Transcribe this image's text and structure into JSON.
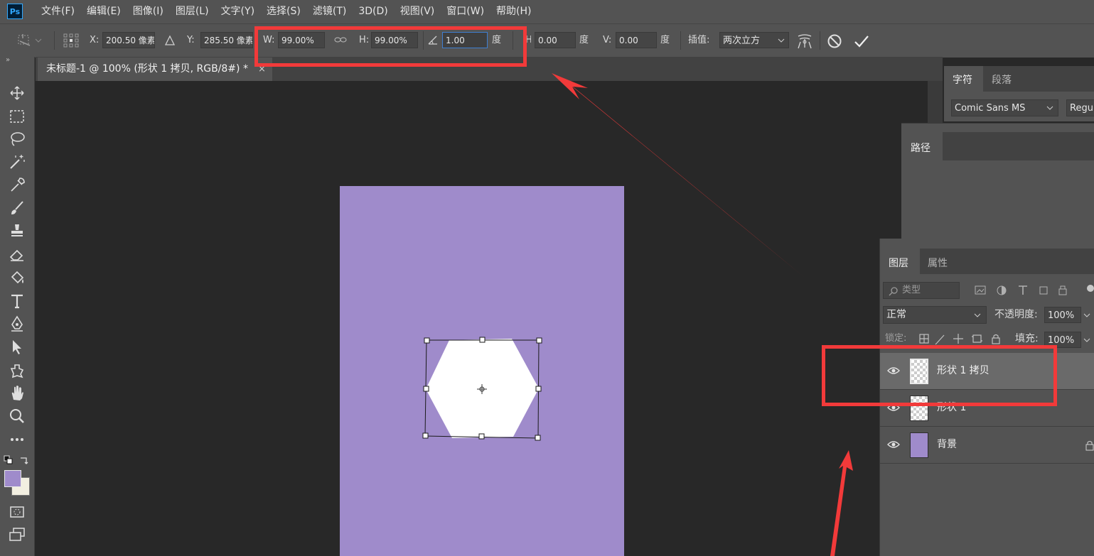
{
  "app": {
    "logo_text": "Ps"
  },
  "menu": [
    "文件(F)",
    "编辑(E)",
    "图像(I)",
    "图层(L)",
    "文字(Y)",
    "选择(S)",
    "滤镜(T)",
    "3D(D)",
    "视图(V)",
    "窗口(W)",
    "帮助(H)"
  ],
  "options": {
    "x_label": "X:",
    "x_value": "200.50 像素",
    "y_label": "Y:",
    "y_value": "285.50 像素",
    "w_label": "W:",
    "w_value": "99.00%",
    "h_label": "H:",
    "h_value": "99.00%",
    "angle_value": "1.00",
    "angle_unit": "度",
    "hskew_label": "H:",
    "hskew_value": "0.00",
    "hskew_unit": "度",
    "vskew_label": "V:",
    "vskew_value": "0.00",
    "vskew_unit": "度",
    "interp_label": "插值:",
    "interp_value": "两次立方"
  },
  "document": {
    "tab_title": "未标题-1 @ 100% (形状 1 拷贝, RGB/8#) *",
    "close_glyph": "×"
  },
  "colors": {
    "accent_red": "#f23a3a",
    "canvas": "#9f8bcb",
    "foreground": "#9f8bcb",
    "background": "#f2efe1"
  },
  "character_panel": {
    "tabs": [
      "字符",
      "段落"
    ],
    "font_family": "Comic Sans MS",
    "font_style": "Regular"
  },
  "paths_panel": {
    "tab": "路径"
  },
  "layers_panel": {
    "tabs": [
      "图层",
      "属性"
    ],
    "filter_placeholder": "类型",
    "blend_mode": "正常",
    "opacity_label": "不透明度:",
    "opacity_value": "100%",
    "lock_label": "锁定:",
    "fill_label": "填充:",
    "fill_value": "100%",
    "layers": [
      {
        "name": "形状 1 拷贝",
        "selected": true
      },
      {
        "name": "形状 1",
        "selected": false
      },
      {
        "name": "背景",
        "selected": false,
        "locked": true
      }
    ]
  }
}
